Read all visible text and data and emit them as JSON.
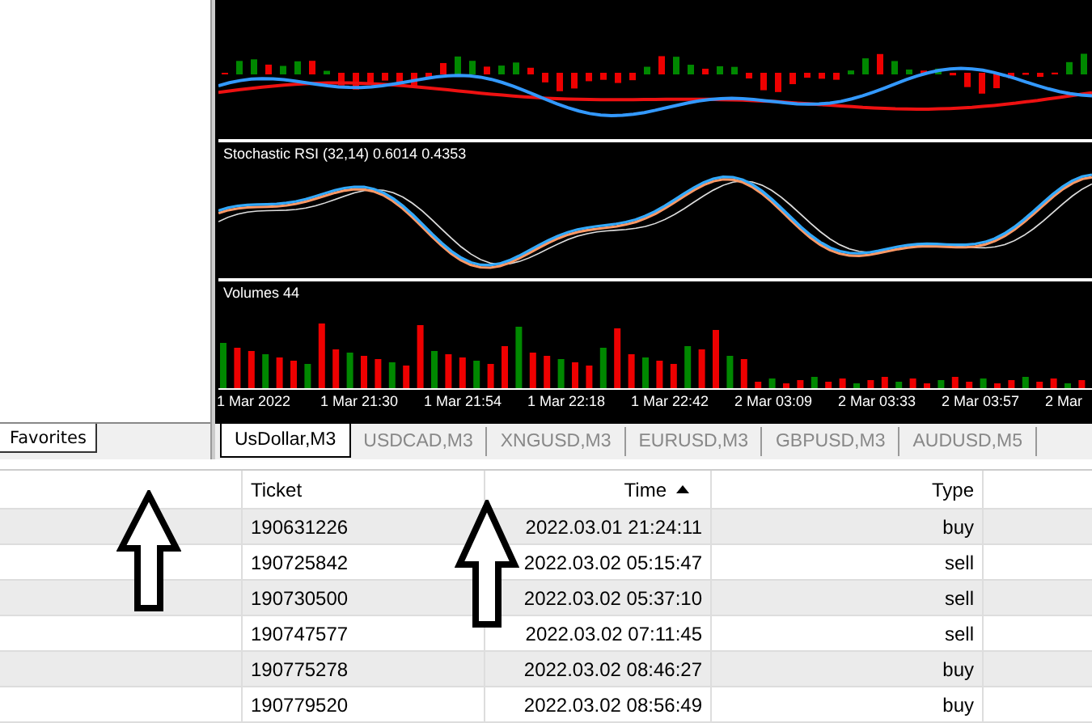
{
  "sidebar": {
    "tabs": [
      {
        "label": "Favorites",
        "selected": true
      }
    ]
  },
  "chart": {
    "panels": [
      {
        "kind": "macd"
      },
      {
        "kind": "stochrsi",
        "label": "Stochastic RSI (32,14) 0.6014 0.4353"
      },
      {
        "kind": "volume",
        "label": "Volumes 44"
      }
    ],
    "time_axis": [
      "1 Mar 2022",
      "1 Mar 21:30",
      "1 Mar 21:54",
      "1 Mar 22:18",
      "1 Mar 22:42",
      "2 Mar 03:09",
      "2 Mar 03:33",
      "2 Mar 03:57",
      "2 Mar"
    ]
  },
  "chart_tabs": [
    {
      "label": "UsDollar,M3",
      "selected": true
    },
    {
      "label": "USDCAD,M3",
      "selected": false
    },
    {
      "label": "XNGUSD,M3",
      "selected": false
    },
    {
      "label": "EURUSD,M3",
      "selected": false
    },
    {
      "label": "GBPUSD,M3",
      "selected": false
    },
    {
      "label": "AUDUSD,M5",
      "selected": false
    }
  ],
  "table": {
    "columns": [
      {
        "label": "Ticket",
        "sorted": false
      },
      {
        "label": "Time",
        "sorted": true
      },
      {
        "label": "Type",
        "sorted": false
      }
    ],
    "rows": [
      [
        "190631226",
        "2022.03.01 21:24:11",
        "buy"
      ],
      [
        "190725842",
        "2022.03.02 05:15:47",
        "sell"
      ],
      [
        "190730500",
        "2022.03.02 05:37:10",
        "sell"
      ],
      [
        "190747577",
        "2022.03.02 07:11:45",
        "sell"
      ],
      [
        "190775278",
        "2022.03.02 08:46:27",
        "buy"
      ],
      [
        "190779520",
        "2022.03.02 08:56:49",
        "buy"
      ]
    ]
  }
}
